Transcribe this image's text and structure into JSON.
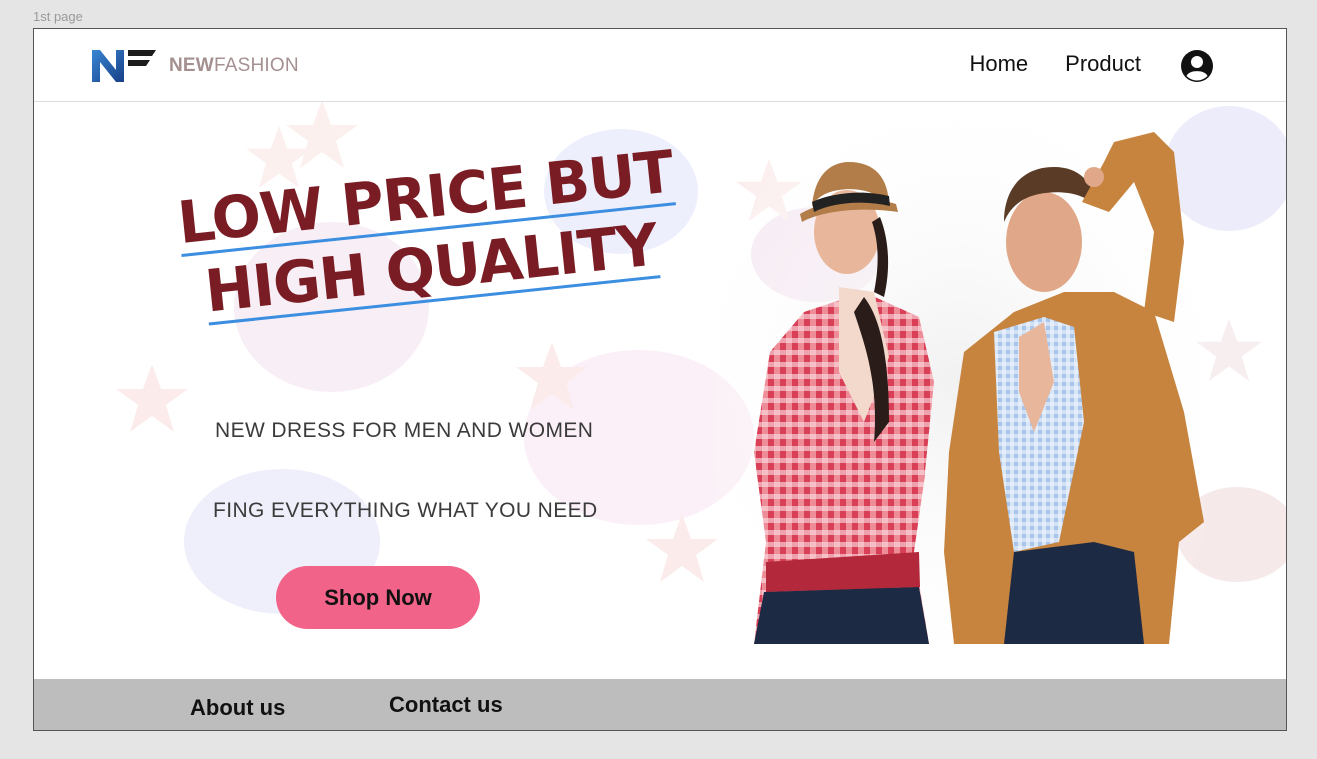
{
  "canvas": {
    "label": "1st page"
  },
  "header": {
    "brand_bold": "NEW",
    "brand_light": "FASHION",
    "nav": [
      {
        "label": "Home"
      },
      {
        "label": "Product"
      }
    ],
    "icons": {
      "logo": "nf-logo",
      "account": "account-circle-icon"
    }
  },
  "hero": {
    "headline_line1": "LOW PRICE BUT",
    "headline_line2": "HIGH QUALITY",
    "tagline1": "NEW DRESS FOR MEN AND WOMEN",
    "tagline2": "FING EVERYTHING WHAT YOU NEED",
    "cta_label": "Shop Now",
    "image": "fashion-couple-photo"
  },
  "footer": {
    "links": [
      {
        "label": "About us"
      },
      {
        "label": "Contact us"
      }
    ]
  },
  "colors": {
    "headline": "#7a1c24",
    "underline": "#3b8ee0",
    "cta": "#f2638a",
    "footer_bg": "#bdbdbd",
    "logo_blue": "#1e4f9c"
  }
}
